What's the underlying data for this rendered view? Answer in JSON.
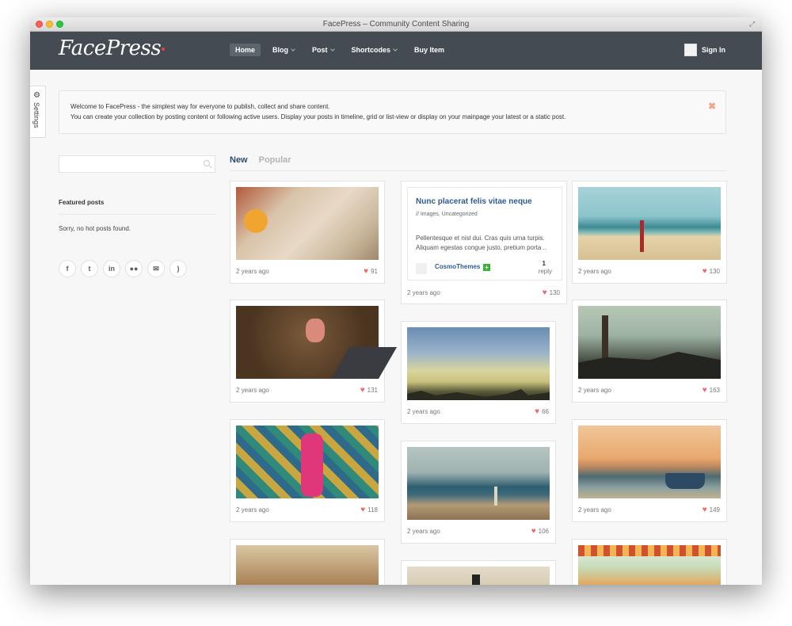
{
  "window": {
    "title": "FacePress – Community Content Sharing"
  },
  "header": {
    "logo": "FacePress",
    "nav": [
      {
        "label": "Home",
        "active": true,
        "dropdown": false
      },
      {
        "label": "Blog",
        "active": false,
        "dropdown": true
      },
      {
        "label": "Post",
        "active": false,
        "dropdown": true
      },
      {
        "label": "Shortcodes",
        "active": false,
        "dropdown": true
      },
      {
        "label": "Buy Item",
        "active": false,
        "dropdown": false
      }
    ],
    "signin_label": "Sign In"
  },
  "settings": {
    "label": "Settings",
    "icon": "gear-icon"
  },
  "welcome": {
    "line1": "Welcome to FacePress - the simplest way for everyone to publish, collect and share content.",
    "line2": "You can create your collection by posting content or following active users. Display your posts in timeline, grid or list-view or display on your mainpage your latest or a static post.",
    "close_icon": "close-icon"
  },
  "sidebar": {
    "search": {
      "value": "",
      "placeholder": ""
    },
    "featured_title": "Featured posts",
    "featured_empty": "Sorry, no hot posts found.",
    "socials": [
      {
        "icon": "facebook-icon",
        "glyph": "f"
      },
      {
        "icon": "twitter-icon",
        "glyph": "t"
      },
      {
        "icon": "linkedin-icon",
        "glyph": "in"
      },
      {
        "icon": "flickr-icon",
        "glyph": "●●"
      },
      {
        "icon": "email-icon",
        "glyph": "✉"
      },
      {
        "icon": "rss-icon",
        "glyph": ")"
      }
    ]
  },
  "tabs": [
    {
      "label": "New",
      "active": true
    },
    {
      "label": "Popular",
      "active": false
    }
  ],
  "text_post": {
    "title": "Nunc placerat felis vitae neque",
    "categories": "// Images,  Uncategorized",
    "excerpt": "Pellentesque et nisl dui. Cras quis urna turpis. Aliquam egestas congue justo, pretium porta ..",
    "author": "CosmoThemes",
    "reply_count": "1",
    "reply_label": "reply"
  },
  "posts": [
    {
      "time": "2 years ago",
      "likes": "91"
    },
    {
      "time": "2 years ago",
      "likes": "131"
    },
    {
      "time": "2 years ago",
      "likes": "118"
    },
    {
      "time": "2 years ago",
      "likes": "130"
    },
    {
      "time": "2 years ago",
      "likes": "66"
    },
    {
      "time": "2 years ago",
      "likes": "106"
    },
    {
      "time": "2 years ago",
      "likes": "130"
    },
    {
      "time": "2 years ago",
      "likes": "163"
    },
    {
      "time": "2 years ago",
      "likes": "149"
    }
  ],
  "colors": {
    "header_bg": "#444b52",
    "link": "#2c5b94",
    "heart": "#ee6767",
    "tab_active": "#2e4d6b"
  }
}
